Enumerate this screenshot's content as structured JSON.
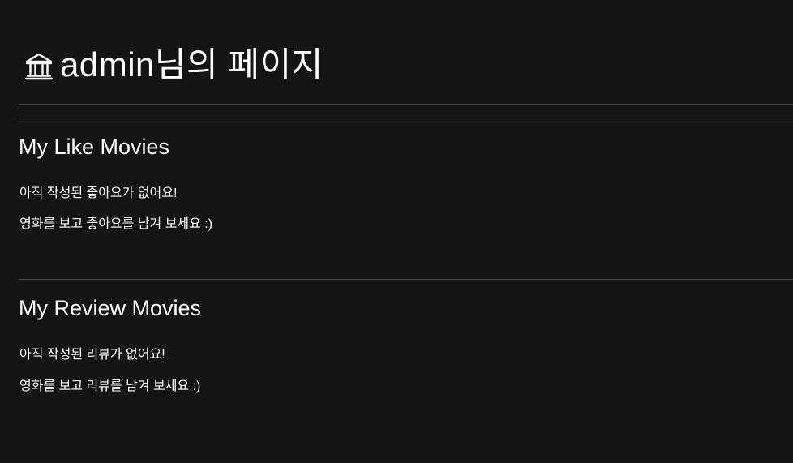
{
  "header": {
    "icon": "museum-icon",
    "title": "admin님의 페이지"
  },
  "like_section": {
    "title": "My Like Movies",
    "empty_message": "아직 작성된 좋아요가 없어요!",
    "hint_message": "영화를 보고 좋아요를 남겨 보세요 :)"
  },
  "review_section": {
    "title": "My Review Movies",
    "empty_message": "아직 작성된 리뷰가 없어요!",
    "hint_message": "영화를 보고 리뷰를 남겨 보세요 :)"
  },
  "colors": {
    "background": "#141414",
    "text": "#ffffff",
    "divider": "#4a4a4a"
  }
}
